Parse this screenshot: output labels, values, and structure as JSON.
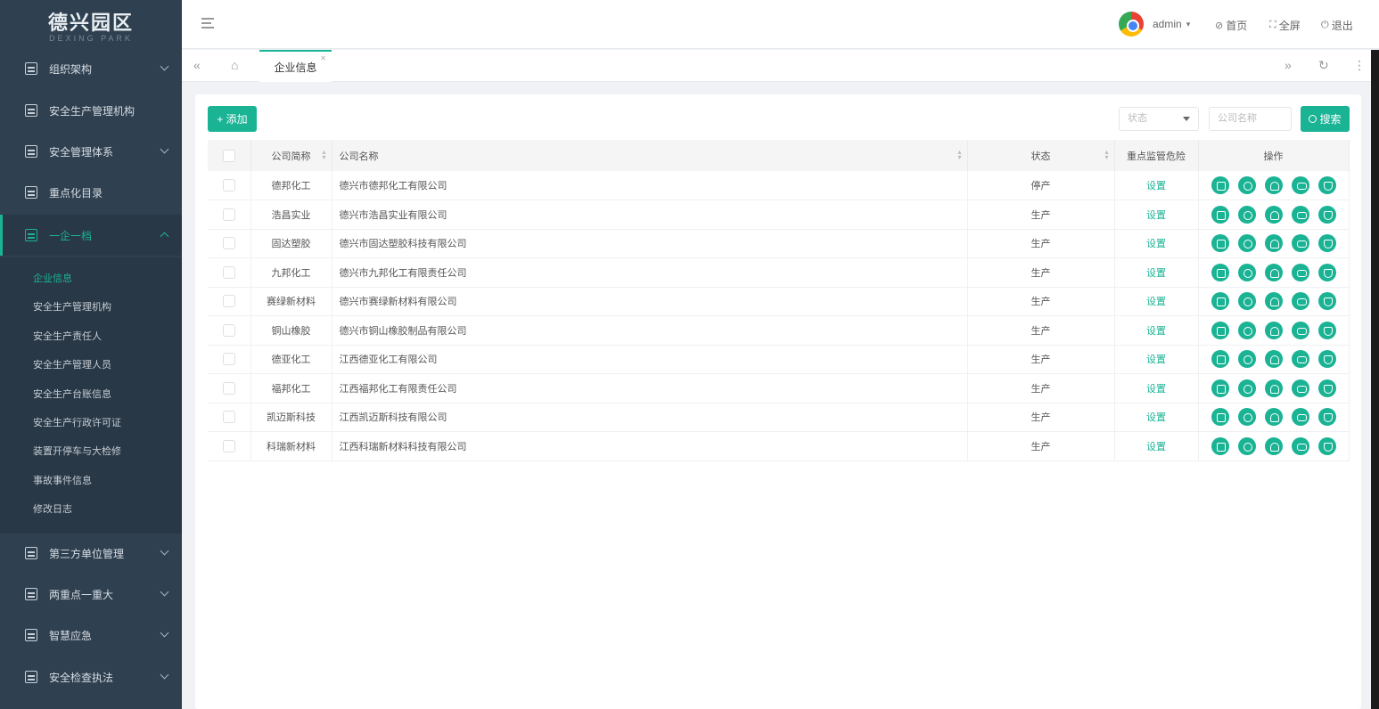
{
  "logo": {
    "title": "德兴园区",
    "subtitle": "DEXING PARK"
  },
  "sidebar": {
    "items": [
      {
        "label": "组织架构",
        "expandable": true
      },
      {
        "label": "安全生产管理机构",
        "expandable": false
      },
      {
        "label": "安全管理体系",
        "expandable": true
      },
      {
        "label": "重点化目录",
        "expandable": false
      },
      {
        "label": "一企一档",
        "expandable": true,
        "active": true
      },
      {
        "label": "第三方单位管理",
        "expandable": true
      },
      {
        "label": "两重点一重大",
        "expandable": true
      },
      {
        "label": "智慧应急",
        "expandable": true
      },
      {
        "label": "安全检查执法",
        "expandable": true
      }
    ],
    "submenu": [
      {
        "label": "企业信息",
        "active": true
      },
      {
        "label": "安全生产管理机构"
      },
      {
        "label": "安全生产责任人"
      },
      {
        "label": "安全生产管理人员"
      },
      {
        "label": "安全生产台账信息"
      },
      {
        "label": "安全生产行政许可证"
      },
      {
        "label": "装置开停车与大检修"
      },
      {
        "label": "事故事件信息"
      },
      {
        "label": "修改日志"
      }
    ]
  },
  "topbar": {
    "user": "admin",
    "home_label": "首页",
    "fullscreen_label": "全屏",
    "logout_label": "退出"
  },
  "tabs": [
    {
      "label": "企业信息"
    }
  ],
  "toolbar": {
    "add_label": "+ 添加",
    "status_placeholder": "状态",
    "name_placeholder": "公司名称",
    "search_label": "搜索"
  },
  "table": {
    "headers": [
      "",
      "公司简称",
      "公司名称",
      "状态",
      "重点监管危险",
      "操作"
    ],
    "rows": [
      {
        "short": "德邦化工",
        "name": "德兴市德邦化工有限公司",
        "status": "停产",
        "link": "设置"
      },
      {
        "short": "浩昌实业",
        "name": "德兴市浩昌实业有限公司",
        "status": "生产",
        "link": "设置"
      },
      {
        "short": "固达塑胶",
        "name": "德兴市固达塑胶科技有限公司",
        "status": "生产",
        "link": "设置"
      },
      {
        "short": "九邦化工",
        "name": "德兴市九邦化工有限责任公司",
        "status": "生产",
        "link": "设置"
      },
      {
        "short": "赛绿新材料",
        "name": "德兴市赛绿新材料有限公司",
        "status": "生产",
        "link": "设置"
      },
      {
        "short": "铜山橡胶",
        "name": "德兴市铜山橡胶制品有限公司",
        "status": "生产",
        "link": "设置"
      },
      {
        "short": "德亚化工",
        "name": "江西德亚化工有限公司",
        "status": "生产",
        "link": "设置"
      },
      {
        "short": "福邦化工",
        "name": "江西福邦化工有限责任公司",
        "status": "生产",
        "link": "设置"
      },
      {
        "short": "凯迈斯科技",
        "name": "江西凯迈斯科技有限公司",
        "status": "生产",
        "link": "设置"
      },
      {
        "short": "科瑞新材料",
        "name": "江西科瑞新材料科技有限公司",
        "status": "生产",
        "link": "设置"
      }
    ],
    "op_icons": [
      "edit-icon",
      "view-icon",
      "user-icon",
      "message-icon",
      "delete-icon"
    ]
  },
  "colors": {
    "accent": "#1ab394",
    "sidebar": "#2f4050"
  }
}
